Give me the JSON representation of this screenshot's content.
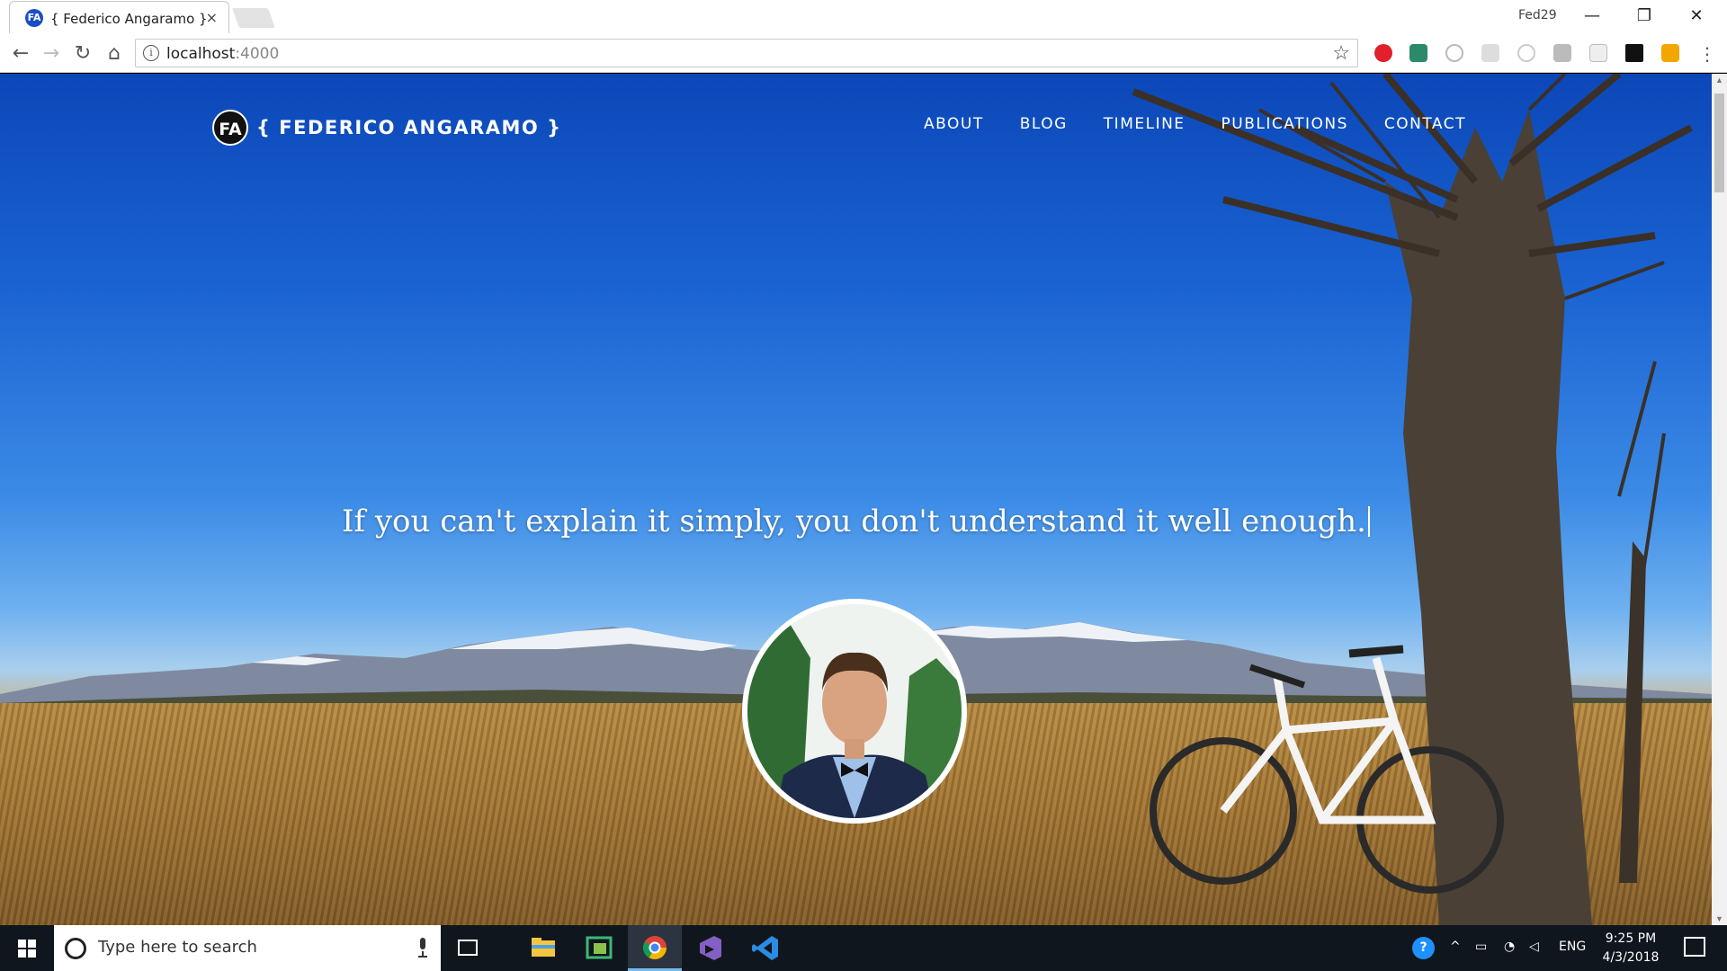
{
  "browser": {
    "tab_title": "{ Federico Angaramo }",
    "tab_favicon": "FA",
    "tab_close": "×",
    "profile": "Fed29",
    "url_host": "localhost",
    "url_port": ":4000",
    "url_info_icon": "i"
  },
  "site": {
    "logo": "FA",
    "brand": "{ FEDERICO ANGARAMO }",
    "nav": {
      "about": "ABOUT",
      "blog": "BLOG",
      "timeline": "TIMELINE",
      "publications": "PUBLICATIONS",
      "contact": "CONTACT"
    },
    "quote": "If you can't explain it simply, you don't understand it well enough."
  },
  "taskbar": {
    "search_placeholder": "Type here to search",
    "language": "ENG",
    "time": "9:25 PM",
    "date": "4/3/2018",
    "apps": [
      "start-icon",
      "task-view-icon",
      "file-explorer-icon",
      "store-icon",
      "chrome-icon",
      "visual-studio-icon",
      "vscode-icon"
    ]
  },
  "colors": {
    "sky_top": "#0c47b8",
    "sky_bottom": "#6fb1f0",
    "grass": "#b48a45",
    "taskbar": "#10161d",
    "accent": "#76b9ed"
  }
}
